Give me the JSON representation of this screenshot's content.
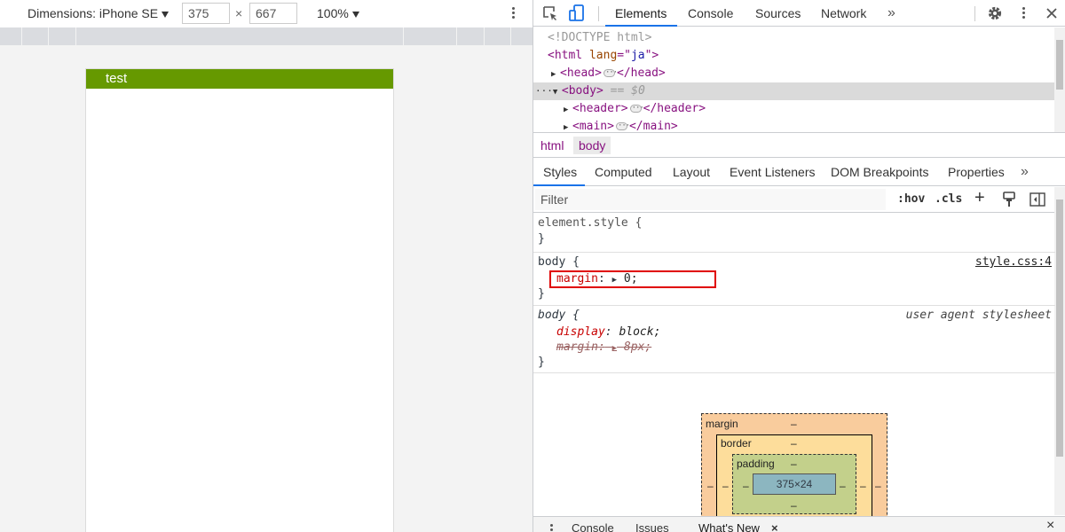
{
  "device_toolbar": {
    "dimensions_label": "Dimensions: iPhone SE",
    "width_value": "375",
    "times": "×",
    "height_value": "667",
    "zoom": "100%",
    "more_icon": "kebab-menu-icon"
  },
  "emulated_page": {
    "header_text": "test",
    "header_color": "#669900"
  },
  "devtools": {
    "icons": {
      "inspect": "inspect-element-icon",
      "device": "device-toolbar-icon",
      "settings": "gear-icon",
      "more": "kebab-menu-icon",
      "close": "close-icon",
      "overflow": "chevron-double-right-icon"
    },
    "top_tabs": [
      "Elements",
      "Console",
      "Sources",
      "Network"
    ],
    "active_top_tab": "Elements",
    "accent": "#1a73e8",
    "dom": {
      "doctype": "<!DOCTYPE html>",
      "html_open_tag": "<html",
      "html_attr_name": "lang",
      "html_attr_eq": "=\"",
      "html_attr_value": "ja",
      "html_attr_close": "\">",
      "head_open": "<head>",
      "head_close": "</head>",
      "body_open": "<body>",
      "body_marker": "== $0",
      "header_open": "<header>",
      "header_close": "</header>",
      "main_open": "<main>",
      "main_close": "</main>",
      "row_ellipsis": "···"
    },
    "breadcrumbs": [
      "html",
      "body"
    ],
    "styles_tabs": [
      "Styles",
      "Computed",
      "Layout",
      "Event Listeners",
      "DOM Breakpoints",
      "Properties"
    ],
    "active_styles_tab": "Styles",
    "filter_placeholder": "Filter",
    "filter_buttons": {
      "hov": ":hov",
      "cls": ".cls",
      "add": "+"
    },
    "rules": {
      "element_style_selector": "element.style {",
      "close_brace": "}",
      "body_selector": "body {",
      "body_source": "style.css:4",
      "body_prop_name": "margin",
      "body_prop_value": "0;",
      "ua_selector": "body {",
      "ua_source": "user agent stylesheet",
      "ua_prop1_name": "display",
      "ua_prop1_value": "block;",
      "ua_prop2_name": "margin",
      "ua_prop2_value": "8px;",
      "colon": ":"
    },
    "box_model": {
      "margin_label": "margin",
      "border_label": "border",
      "padding_label": "padding",
      "content_size": "375×24",
      "dash": "–"
    },
    "drawer": {
      "tabs": [
        "Console",
        "Issues",
        "What's New"
      ],
      "close_x": "×"
    }
  }
}
